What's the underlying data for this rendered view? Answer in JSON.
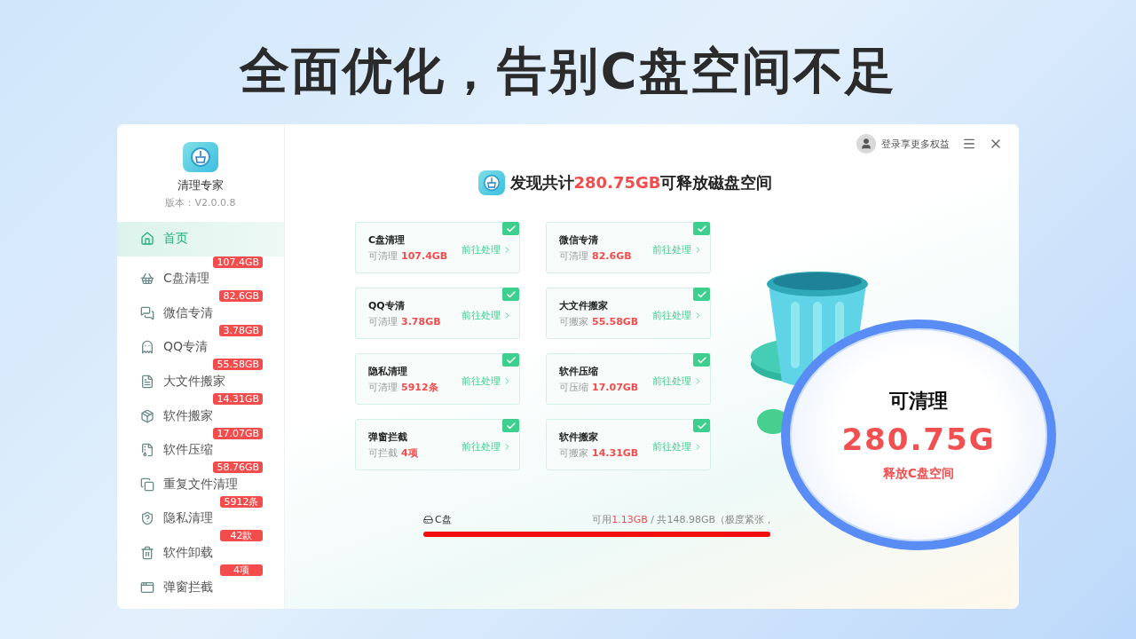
{
  "headline": "全面优化，告别C盘空间不足",
  "app": {
    "name": "清理专家",
    "version": "版本：V2.0.0.8"
  },
  "nav": [
    {
      "kind": "home",
      "label": "首页",
      "selected": true
    },
    {
      "kind": "basket",
      "label": "C盘清理",
      "badge": "107.4GB",
      "selected": false
    },
    {
      "kind": "chat",
      "label": "微信专清",
      "badge": "82.6GB",
      "selected": false
    },
    {
      "kind": "penguin",
      "label": "QQ专清",
      "badge": "3.78GB",
      "selected": false
    },
    {
      "kind": "file",
      "label": "大文件搬家",
      "badge": "55.58GB",
      "selected": false
    },
    {
      "kind": "box",
      "label": "软件搬家",
      "badge": "14.31GB",
      "selected": false
    },
    {
      "kind": "zip",
      "label": "软件压缩",
      "badge": "17.07GB",
      "selected": false
    },
    {
      "kind": "copy",
      "label": "重复文件清理",
      "badge": "58.76GB",
      "selected": false
    },
    {
      "kind": "shield",
      "label": "隐私清理",
      "badge": "5912条",
      "selected": false
    },
    {
      "kind": "uninstall",
      "label": "软件卸载",
      "badge": "42款",
      "selected": false
    },
    {
      "kind": "popup",
      "label": "弹窗拦截",
      "badge": "4项",
      "selected": false
    }
  ],
  "header": {
    "login": "登录享更多权益"
  },
  "summary": {
    "before": "发现共计",
    "amount": "280.75GB",
    "after": "可释放磁盘空间"
  },
  "cards": [
    {
      "title": "C盘清理",
      "label": "可清理",
      "value": "107.4GB",
      "action": "前往处理",
      "checked": true
    },
    {
      "title": "微信专清",
      "label": "可清理",
      "value": "82.6GB",
      "action": "前往处理",
      "checked": true
    },
    {
      "title": "QQ专清",
      "label": "可清理",
      "value": "3.78GB",
      "action": "前往处理",
      "checked": true
    },
    {
      "title": "大文件搬家",
      "label": "可搬家",
      "value": "55.58GB",
      "action": "前往处理",
      "checked": true
    },
    {
      "title": "隐私清理",
      "label": "可清理",
      "value": "5912条",
      "action": "前往处理",
      "checked": true
    },
    {
      "title": "软件压缩",
      "label": "可压缩",
      "value": "17.07GB",
      "action": "前往处理",
      "checked": true
    },
    {
      "title": "弹窗拦截",
      "label": "可拦截",
      "value": "4项",
      "action": "前往处理",
      "checked": true
    },
    {
      "title": "软件搬家",
      "label": "可搬家",
      "value": "14.31GB",
      "action": "前往处理",
      "checked": true
    }
  ],
  "disk": {
    "name": "C盘",
    "available_label": "可用",
    "available": "1.13GB",
    "total": "/  共148.98GB（极度紧张，",
    "level": 0.99
  },
  "result": {
    "title": "可清理",
    "amount": "280.75G",
    "subtitle": "释放C盘空间"
  }
}
